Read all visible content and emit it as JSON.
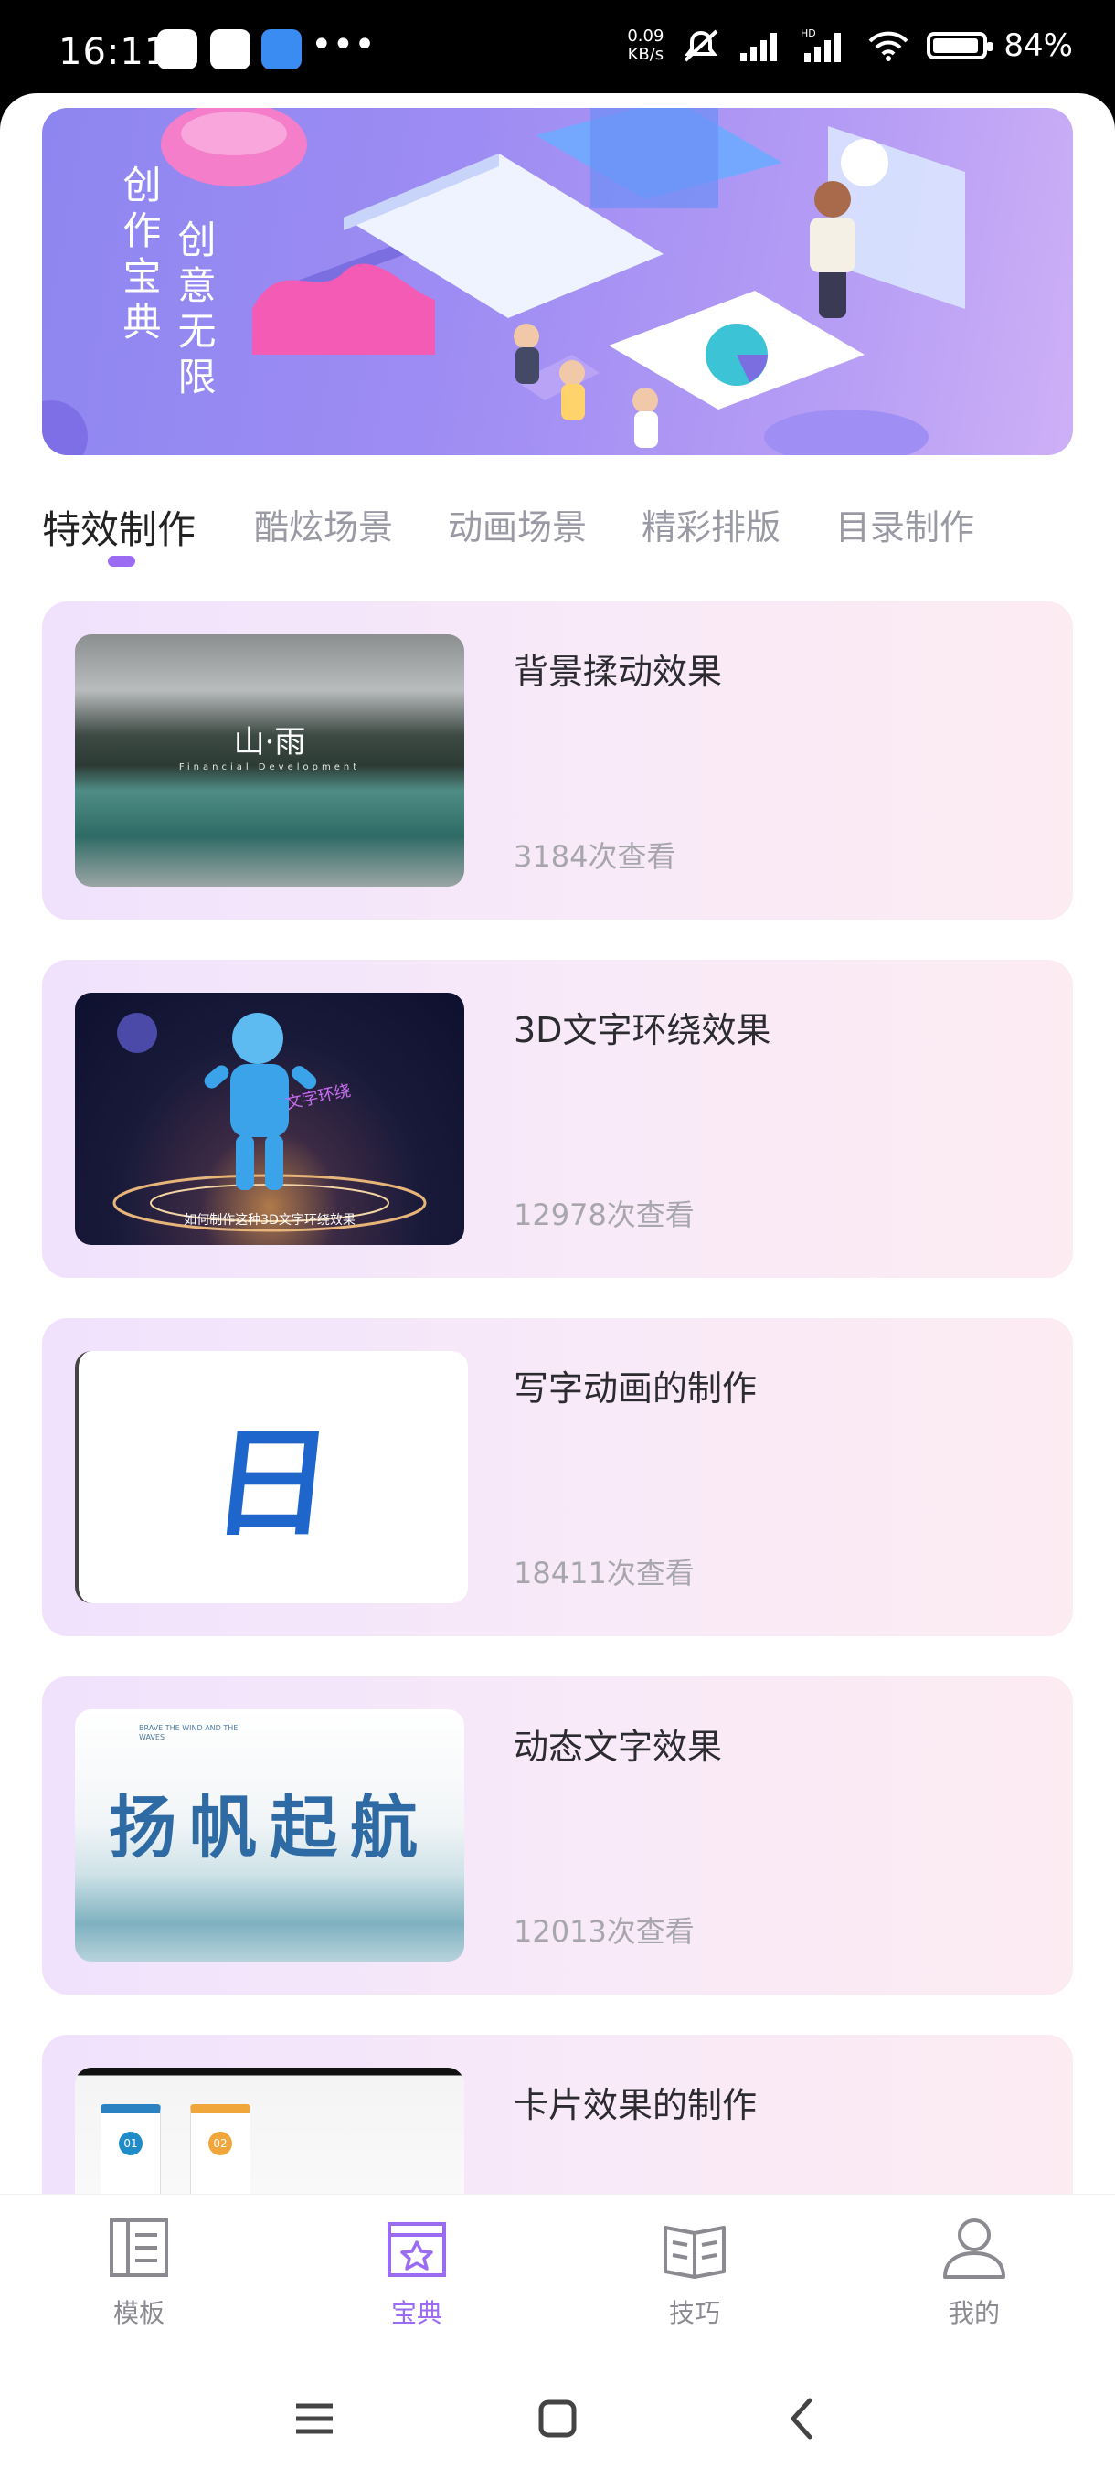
{
  "status_bar": {
    "time": "16:11",
    "overflow": "•••",
    "net_speed_value": "0.09",
    "net_speed_unit": "KB/s",
    "battery_percent": "84%",
    "battery_level": 0.84,
    "icons": [
      "mute-icon",
      "signal-icon",
      "hd-signal-icon",
      "wifi-icon",
      "battery-icon"
    ]
  },
  "banner": {
    "line1": "创作宝典",
    "line2": "创意无限",
    "colors": {
      "start": "#8e86f0",
      "end": "#cdb0f6"
    }
  },
  "tabs": [
    {
      "label": "特效制作",
      "active": true
    },
    {
      "label": "酷炫场景",
      "active": false
    },
    {
      "label": "动画场景",
      "active": false
    },
    {
      "label": "精彩排版",
      "active": false
    },
    {
      "label": "目录制作",
      "active": false
    }
  ],
  "cards": [
    {
      "title": "背景揉动效果",
      "views": "3184次查看",
      "thumb_text": "山·雨",
      "thumb_sub": "Financial Development"
    },
    {
      "title": "3D文字环绕效果",
      "views": "12978次查看",
      "thumb_text": "如何制作这种3D文字环绕效果",
      "thumb_sub": "文字环绕"
    },
    {
      "title": "写字动画的制作",
      "views": "18411次查看",
      "thumb_text": "日",
      "thumb_sub": ""
    },
    {
      "title": "动态文字效果",
      "views": "12013次查看",
      "thumb_text": "扬帆起航",
      "thumb_sub": "BRAVE THE WIND AND THE WAVES"
    },
    {
      "title": "卡片效果的制作",
      "views": "",
      "thumb_text": "01",
      "thumb_sub": "02"
    }
  ],
  "bottom_nav": [
    {
      "label": "模板",
      "icon": "template-icon",
      "active": false
    },
    {
      "label": "宝典",
      "icon": "book-star-icon",
      "active": true
    },
    {
      "label": "技巧",
      "icon": "open-book-icon",
      "active": false
    },
    {
      "label": "我的",
      "icon": "user-icon",
      "active": false
    }
  ],
  "system_nav": [
    "menu-icon",
    "home-icon",
    "back-icon"
  ],
  "colors": {
    "accent": "#9b6cf2",
    "card_start": "#f0e2fc",
    "card_end": "#fcebf1"
  }
}
